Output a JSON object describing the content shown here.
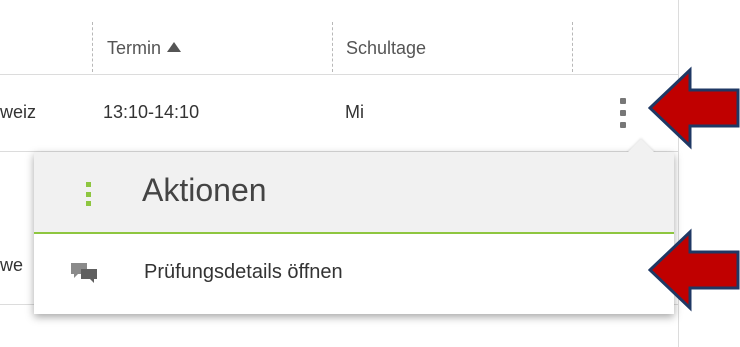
{
  "table": {
    "headers": {
      "termin": "Termin",
      "schultage": "Schultage"
    },
    "rows": [
      {
        "lead": "weiz",
        "termin": "13:10-14:10",
        "schultage": "Mi"
      },
      {
        "lead": "we"
      }
    ]
  },
  "actions_popup": {
    "title": "Aktionen",
    "items": [
      {
        "label": "Prüfungsdetails öffnen",
        "icon": "chat-bubbles-icon"
      }
    ]
  },
  "colors": {
    "accent_green": "#8ec63f",
    "annotation_arrow_fill": "#c00000",
    "annotation_arrow_outline": "#1f3864"
  }
}
